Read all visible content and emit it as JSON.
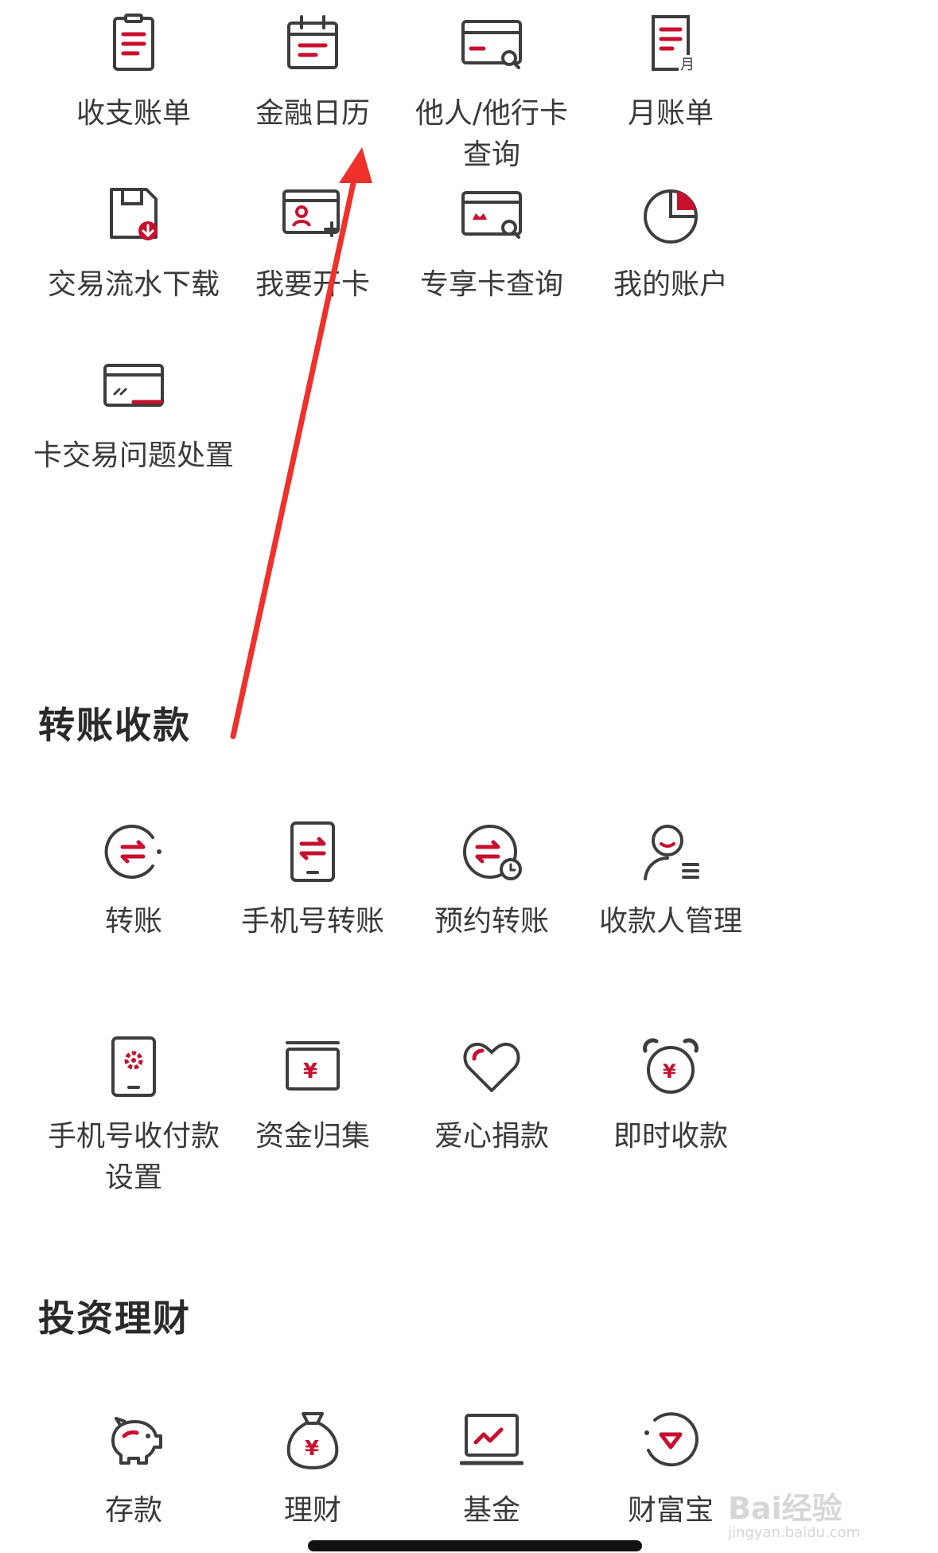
{
  "colors": {
    "accent": "#c8102e",
    "icon_stroke": "#3d3d3d",
    "text": "#3a3a3a",
    "title": "#2a2a2a",
    "annotation": "#f0302a"
  },
  "account_services": {
    "items": [
      {
        "label": "收支账单",
        "icon": "bill-list-icon"
      },
      {
        "label": "金融日历",
        "icon": "calendar-icon"
      },
      {
        "label": "他人/他行卡\n查询",
        "icon": "card-search-icon"
      },
      {
        "label": "月账单",
        "icon": "monthly-bill-icon"
      },
      {
        "label": "交易流水下载",
        "icon": "save-download-icon"
      },
      {
        "label": "我要开卡",
        "icon": "card-add-user-icon"
      },
      {
        "label": "专享卡查询",
        "icon": "crown-card-search-icon"
      },
      {
        "label": "我的账户",
        "icon": "pie-chart-icon"
      },
      {
        "label": "卡交易问题处置",
        "icon": "card-issue-icon"
      }
    ]
  },
  "transfer": {
    "title": "转账收款",
    "items": [
      {
        "label": "转账",
        "icon": "transfer-circle-icon"
      },
      {
        "label": "手机号转账",
        "icon": "phone-transfer-icon"
      },
      {
        "label": "预约转账",
        "icon": "scheduled-transfer-icon"
      },
      {
        "label": "收款人管理",
        "icon": "payee-management-icon"
      },
      {
        "label": "手机号收付款\n设置",
        "icon": "phone-settings-icon"
      },
      {
        "label": "资金归集",
        "icon": "fund-collection-icon"
      },
      {
        "label": "爱心捐款",
        "icon": "heart-icon"
      },
      {
        "label": "即时收款",
        "icon": "alarm-clock-yuan-icon"
      }
    ]
  },
  "invest": {
    "title": "投资理财",
    "items": [
      {
        "label": "存款",
        "icon": "piggy-bank-icon"
      },
      {
        "label": "理财",
        "icon": "money-bag-icon"
      },
      {
        "label": "基金",
        "icon": "laptop-chart-icon"
      },
      {
        "label": "财富宝",
        "icon": "diamond-circle-icon"
      }
    ]
  },
  "watermark": {
    "main": "Bai经验",
    "sub": "jingyan.baidu.com"
  }
}
